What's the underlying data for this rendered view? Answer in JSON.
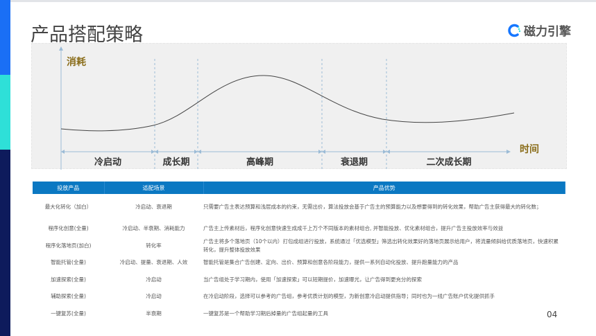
{
  "title": "产品搭配策略",
  "logo": {
    "text": "磁力引擎",
    "accent": "#1677ff"
  },
  "chart": {
    "ylabel": "消耗",
    "xlabel": "时间",
    "phases": [
      "冷启动",
      "成长期",
      "高峰期",
      "衰退期",
      "二次成长期"
    ]
  },
  "table": {
    "headers": [
      "投放产品",
      "适配场景",
      "产品优势"
    ],
    "rows": [
      [
        "最大化转化（加白）",
        "冷启动、衰退期",
        "只需要广告主表达预算和浅层成本的约束，无需出价，算法投放会基于广告主的预算能力以及想要得到的转化效果，帮助广告主获得最大的转化数；"
      ],
      [
        "程序化创意(全量)",
        "冷启动、半衰期、消耗能力",
        "广告主上传素材后，程序化创意快速生成成千上万个不同版本的素材组合, 并智能投放、优化素材组合，提升广告主投放效率与效益"
      ],
      [
        "程序化落地页(加白)",
        "转化率",
        "广告主将多个落地页（10个以内）打包成组进行投放，系统通过「优选模型」筛选出转化效果好的落地页展示给用户，将流量倾斜给优质落地页，快速积累转化，提升整体投放效果"
      ],
      [
        "智能托管(全量)",
        "冷启动、提量、衰退期、人效",
        "智能托管是集合广告创建、定向、出价、预算和创意各阶段能力，提供一系列自动化投放、提升跑量能力的产品"
      ],
      [
        "加速探索(全量)",
        "冷启动",
        "当广告组处于学习期内，使用「加速探索」可以短期提价，加速曝光，让广告得到更充分的探索"
      ],
      [
        "辅助探索(全量)",
        "冷启动",
        "在冷启动阶段，选择可以参考的广告组，参考优质计划的模型，为新创意冷启动提供指导；同时也为一线广告账户优化提供抓手"
      ],
      [
        "一键复苏(全量)",
        "半衰期",
        "一键复苏是一个帮助学习期后掉量的广告组起量的工具"
      ]
    ]
  },
  "page_number": "04",
  "colors": {
    "header": "#0b78c2",
    "axis_label": "#8a6d1a",
    "bar_blue": "#1a6ff5",
    "bar_cyan": "#2ee0d8",
    "bar_navy": "#0e1b5c"
  }
}
